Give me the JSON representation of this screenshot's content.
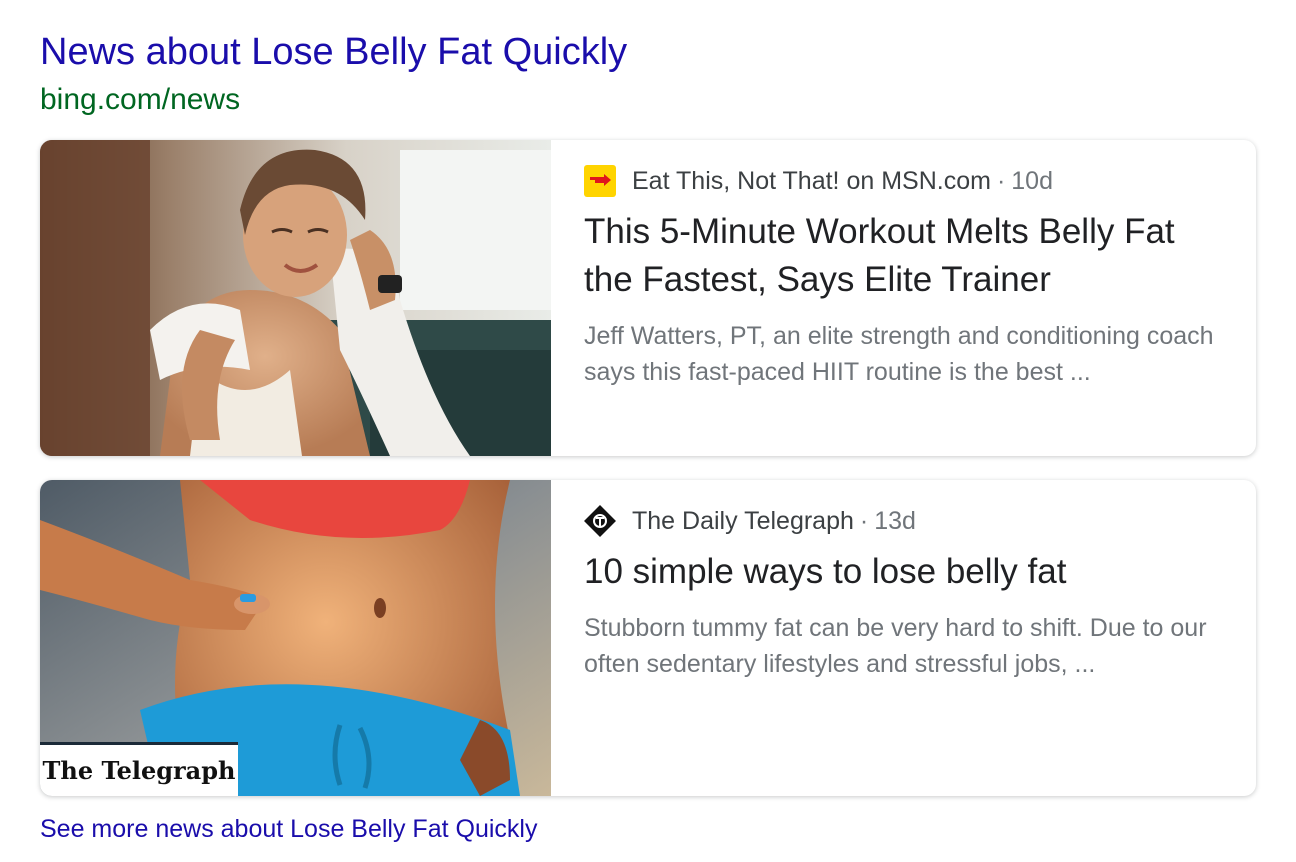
{
  "header": {
    "title": "News about Lose Belly Fat Quickly",
    "source": "bing.com/news"
  },
  "articles": [
    {
      "publisher": "Eat This, Not That! on MSN.com",
      "separator": "·",
      "age": "10d",
      "icon": "eat-this-not-that-logo-icon",
      "icon_color": "#ffd400",
      "title": "This 5-Minute Workout Melts Belly Fat the Fastest, Says Elite Trainer",
      "snippet": "Jeff Watters, PT, an elite strength and conditioning coach says this fast-paced HIIT routine is the best ...",
      "image": "woman-with-towel-photo"
    },
    {
      "publisher": "The Daily Telegraph",
      "separator": "·",
      "age": "13d",
      "icon": "telegraph-logo-icon",
      "icon_color": "#111111",
      "title": "10 simple ways to lose belly fat",
      "snippet": "Stubborn tummy fat can be very hard to shift. Due to our often sedentary lifestyles and stressful jobs, ...",
      "image": "belly-pinch-photo",
      "image_caption": "The Telegraph"
    }
  ],
  "footer": {
    "more_link": "See more news about Lose Belly Fat Quickly"
  },
  "colors": {
    "link": "#1a0dab",
    "url": "#006621",
    "title": "#202124",
    "snippet": "#70757a"
  }
}
